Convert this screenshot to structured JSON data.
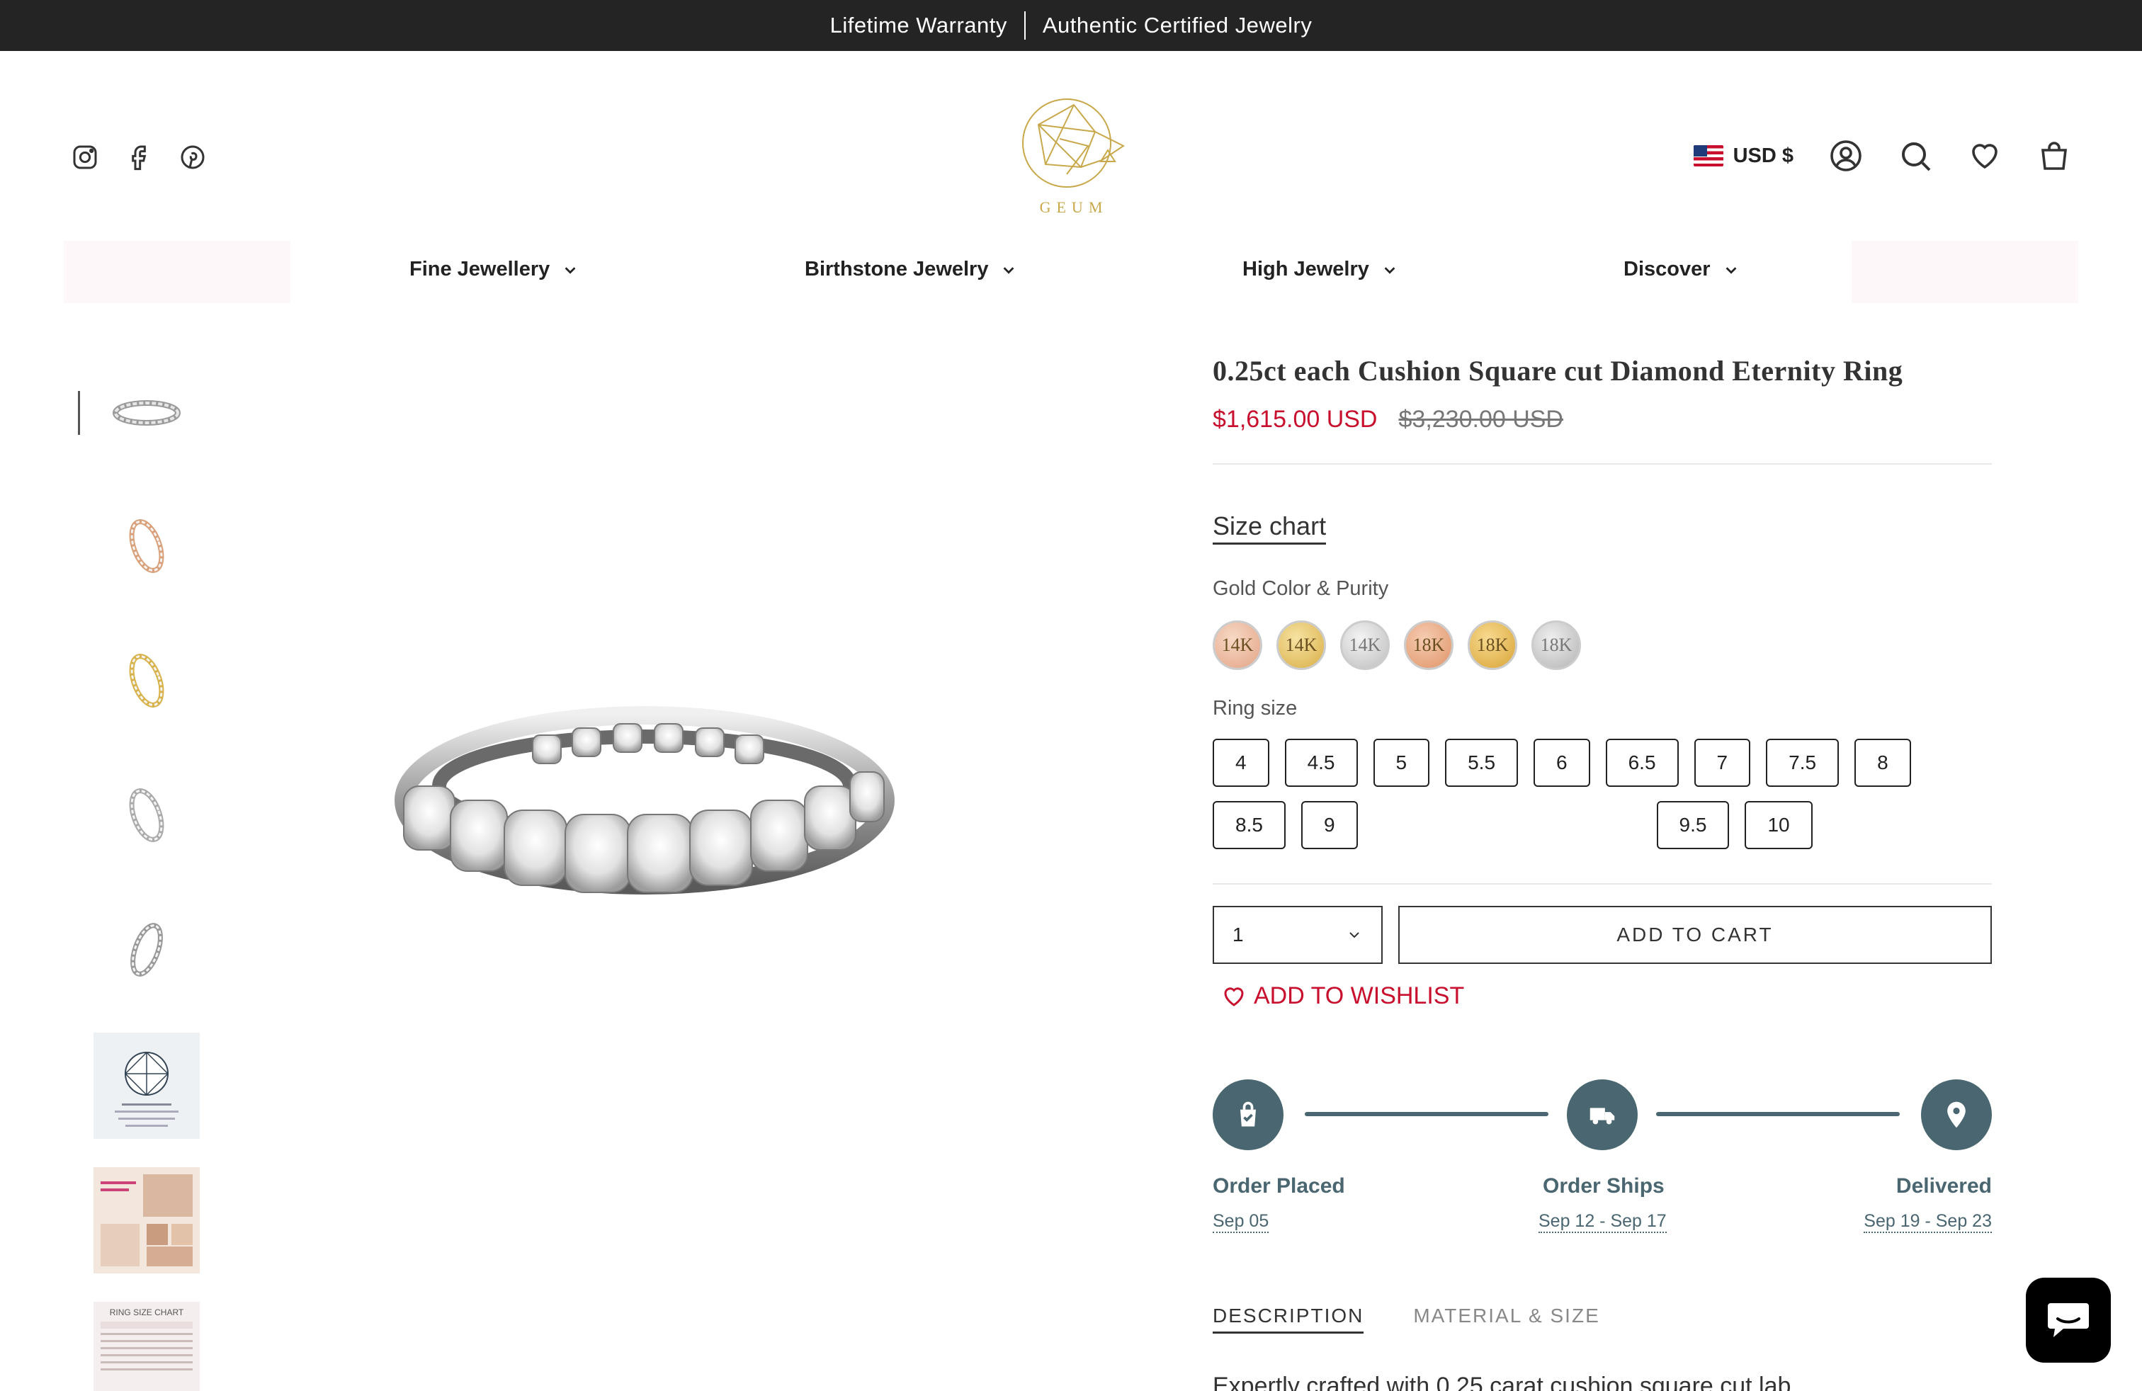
{
  "announcement": {
    "left": "Lifetime Warranty",
    "right": "Authentic Certified Jewelry"
  },
  "header": {
    "brand": "GEUM",
    "social": [
      "instagram-icon",
      "facebook-icon",
      "pinterest-icon"
    ],
    "currency": "USD $",
    "icons": [
      "account-icon",
      "search-icon",
      "heart-icon",
      "cart-icon"
    ]
  },
  "nav": {
    "items": [
      "Fine Jewellery",
      "Birthstone Jewelry",
      "High Jewelry",
      "Discover"
    ]
  },
  "gallery": {
    "thumb_texts": {
      "ring_size_chart": "RING SIZE CHART"
    }
  },
  "product": {
    "title": "0.25ct each Cushion Square cut Diamond Eternity Ring",
    "price_sale": "$1,615.00 USD",
    "price_compare": "$3,230.00 USD",
    "size_chart_label": "Size chart",
    "gold_label": "Gold Color & Purity",
    "swatches": [
      {
        "label": "14K",
        "color": "#e9b59a"
      },
      {
        "label": "14K",
        "color": "#e7c46a"
      },
      {
        "label": "14K",
        "color": "#d9d9d9"
      },
      {
        "label": "18K",
        "color": "#e9ab8a"
      },
      {
        "label": "18K",
        "color": "#e9bf5e"
      },
      {
        "label": "18K",
        "color": "#cfcfcf"
      }
    ],
    "ring_size_label": "Ring size",
    "sizes": [
      "4",
      "4.5",
      "5",
      "5.5",
      "6",
      "6.5",
      "7",
      "7.5",
      "8",
      "8.5",
      "9",
      "9.5",
      "10"
    ],
    "quantity": "1",
    "add_to_cart": "ADD TO CART",
    "wishlist": "ADD TO WISHLIST"
  },
  "shipping": {
    "steps": [
      {
        "title": "Order Placed",
        "date": "Sep 05"
      },
      {
        "title": "Order Ships",
        "date": "Sep 12 - Sep 17"
      },
      {
        "title": "Delivered",
        "date": "Sep 19 - Sep 23"
      }
    ]
  },
  "tabs": [
    "DESCRIPTION",
    "MATERIAL & SIZE"
  ],
  "description_preview": "Expertly crafted with 0.25 carat cushion square cut lab",
  "colors": {
    "accent_red": "#c8102e",
    "timeline": "#4a6670",
    "announce_bg": "#242424",
    "logo_gold": "#c8a84a"
  }
}
